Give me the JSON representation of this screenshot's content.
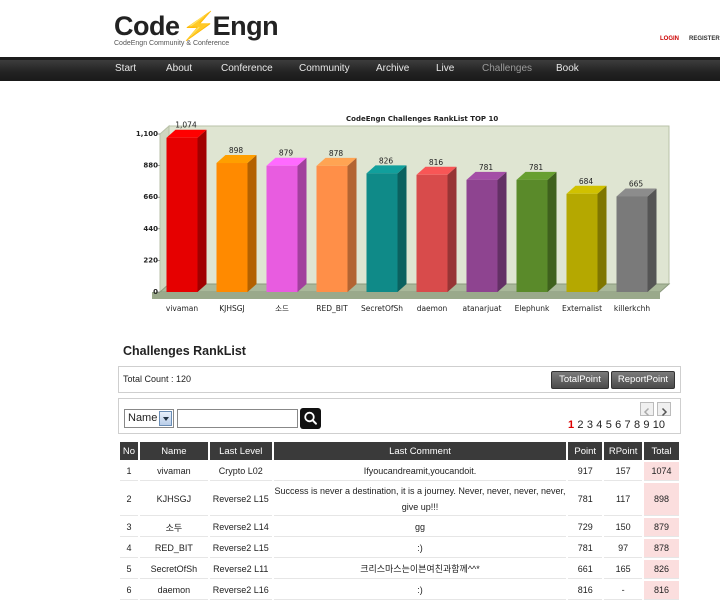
{
  "header": {
    "logo_left": "Code",
    "logo_bolt": "⚡",
    "logo_right": "Engn",
    "logo_sub": "CodeEngn Community & Conference",
    "login": "LOGIN",
    "register": "REGISTER"
  },
  "nav": [
    "Start",
    "About",
    "Conference",
    "Community",
    "Archive",
    "Live",
    "Challenges",
    "Book"
  ],
  "nav_active": "Challenges",
  "chart_data": {
    "type": "bar",
    "title": "CodeEngn Challenges RankList TOP 10",
    "categories": [
      "vivaman",
      "KJHSGJ",
      "소드",
      "RED_BIT",
      "SecretOfSh",
      "daemon",
      "atanarjuat",
      "Elephunk",
      "Externalist",
      "killerkchh"
    ],
    "values": [
      1074,
      898,
      879,
      878,
      826,
      816,
      781,
      781,
      684,
      665
    ],
    "value_labels": [
      "1,074",
      "898",
      "879",
      "878",
      "826",
      "816",
      "781",
      "781",
      "684",
      "665"
    ],
    "colors": [
      "#e60000",
      "#ff8a00",
      "#e85ce0",
      "#ff8f48",
      "#0f8a88",
      "#d84b4b",
      "#8e4490",
      "#5a8a2a",
      "#b5a800",
      "#7a7a7a"
    ],
    "ylim": [
      0,
      1100
    ],
    "yticks": [
      0,
      220,
      440,
      660,
      880,
      1100
    ],
    "ytick_labels": [
      "0",
      "220",
      "440",
      "660",
      "880",
      "1,100"
    ],
    "grid": false,
    "legend": "none"
  },
  "section_title": "Challenges RankList",
  "total_count": "Total Count : 120",
  "buttons": {
    "total_point": "TotalPoint",
    "report_point": "ReportPoint"
  },
  "search": {
    "select_value": "Name",
    "input_value": ""
  },
  "pager": {
    "current": "1",
    "pages": [
      "1",
      "2",
      "3",
      "4",
      "5",
      "6",
      "7",
      "8",
      "9",
      "10"
    ]
  },
  "table": {
    "headers": [
      "No",
      "Name",
      "Last Level",
      "Last Comment",
      "Point",
      "RPoint",
      "Total"
    ],
    "rows": [
      [
        "1",
        "vivaman",
        "Crypto L02",
        "Ifyoucandreamit,youcandoit.",
        "917",
        "157",
        "1074"
      ],
      [
        "2",
        "KJHSGJ",
        "Reverse2 L15",
        "Success is never a destination, it is a journey. Never, never, never, never, give up!!!",
        "781",
        "117",
        "898"
      ],
      [
        "3",
        "소두",
        "Reverse2 L14",
        "gg",
        "729",
        "150",
        "879"
      ],
      [
        "4",
        "RED_BIT",
        "Reverse2 L15",
        ":)",
        "781",
        "97",
        "878"
      ],
      [
        "5",
        "SecretOfSh",
        "Reverse2 L11",
        "크리스마스는이븐여친과함께^^*",
        "661",
        "165",
        "826"
      ],
      [
        "6",
        "daemon",
        "Reverse2 L16",
        ":)",
        "816",
        "-",
        "816"
      ]
    ]
  }
}
